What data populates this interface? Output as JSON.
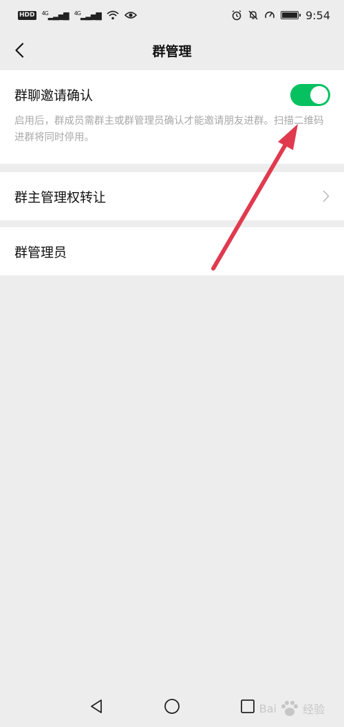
{
  "statusbar": {
    "left_badge": "HD",
    "left_badge_sub": "D",
    "sim1": "4G",
    "sim2": "4G",
    "time": "9:54"
  },
  "navbar": {
    "title": "群管理"
  },
  "invite_confirm": {
    "title": "群聊邀请确认",
    "description": "启用后，群成员需群主或群管理员确认才能邀请朋友进群。扫描二维码进群将同时停用。",
    "enabled": true
  },
  "rows": {
    "transfer_owner": "群主管理权转让",
    "admins": "群管理员"
  },
  "watermark": {
    "text_a": "Bai",
    "text_b": "经验"
  },
  "colors": {
    "background": "#ededed",
    "toggle_on": "#07c160",
    "annotation_arrow": "#e03a4f"
  }
}
